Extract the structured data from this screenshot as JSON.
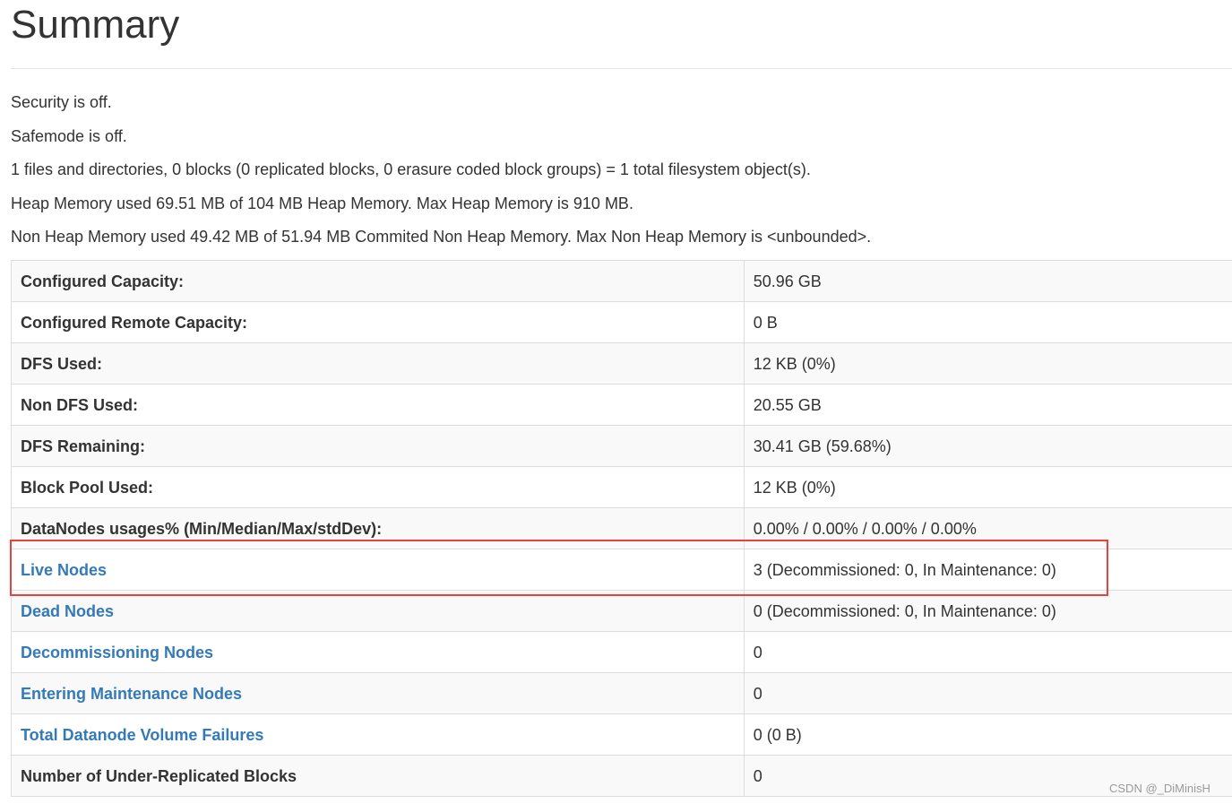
{
  "page": {
    "title": "Summary"
  },
  "info_lines": [
    "Security is off.",
    "Safemode is off.",
    "1 files and directories, 0 blocks (0 replicated blocks, 0 erasure coded block groups) = 1 total filesystem object(s).",
    "Heap Memory used 69.51 MB of 104 MB Heap Memory. Max Heap Memory is 910 MB.",
    "Non Heap Memory used 49.42 MB of 51.94 MB Commited Non Heap Memory. Max Non Heap Memory is <unbounded>."
  ],
  "table": {
    "rows": [
      {
        "label": "Configured Capacity:",
        "value": "50.96 GB",
        "link": false
      },
      {
        "label": "Configured Remote Capacity:",
        "value": "0 B",
        "link": false
      },
      {
        "label": "DFS Used:",
        "value": "12 KB (0%)",
        "link": false
      },
      {
        "label": "Non DFS Used:",
        "value": "20.55 GB",
        "link": false
      },
      {
        "label": "DFS Remaining:",
        "value": "30.41 GB (59.68%)",
        "link": false
      },
      {
        "label": "Block Pool Used:",
        "value": "12 KB (0%)",
        "link": false
      },
      {
        "label": "DataNodes usages% (Min/Median/Max/stdDev):",
        "value": "0.00% / 0.00% / 0.00% / 0.00%",
        "link": false
      },
      {
        "label": "Live Nodes",
        "value": "3 (Decommissioned: 0, In Maintenance: 0)",
        "link": true
      },
      {
        "label": "Dead Nodes",
        "value": "0 (Decommissioned: 0, In Maintenance: 0)",
        "link": true
      },
      {
        "label": "Decommissioning Nodes",
        "value": "0",
        "link": true
      },
      {
        "label": "Entering Maintenance Nodes",
        "value": "0",
        "link": true
      },
      {
        "label": "Total Datanode Volume Failures",
        "value": "0 (0 B)",
        "link": true
      },
      {
        "label": "Number of Under-Replicated Blocks",
        "value": "0",
        "link": false
      }
    ]
  },
  "highlight": {
    "row_label": "Live Nodes",
    "color": "#e8423e"
  },
  "colors": {
    "link": "#337ab7",
    "text": "#333333",
    "stripe": "#f9f9f9",
    "border": "#dddddd"
  },
  "watermark": "CSDN @_DiMinisH"
}
